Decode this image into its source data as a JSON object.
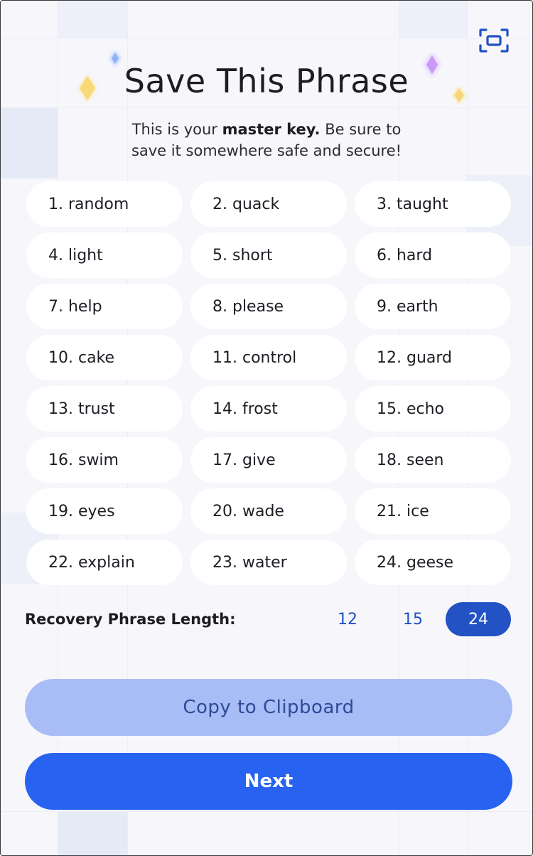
{
  "header": {
    "title": "Save This Phrase",
    "subtitle_pre": "This is your ",
    "subtitle_bold": "master key.",
    "subtitle_post": " Be sure to",
    "subtitle_line2": "save it somewhere safe and secure!",
    "expand_icon": "fullscreen-icon"
  },
  "words": [
    "1. random",
    "2. quack",
    "3. taught",
    "4. light",
    "5. short",
    "6. hard",
    "7. help",
    "8. please",
    "9. earth",
    "10. cake",
    "11. control",
    "12. guard",
    "13. trust",
    "14. frost",
    "15. echo",
    "16. swim",
    "17. give",
    "18. seen",
    "19. eyes",
    "20. wade",
    "21. ice",
    "22. explain",
    "23. water",
    "24. geese"
  ],
  "length": {
    "label": "Recovery Phrase Length:",
    "options": [
      "12",
      "15",
      "24"
    ],
    "selected": "24"
  },
  "actions": {
    "copy_label": "Copy to Clipboard",
    "next_label": "Next"
  },
  "colors": {
    "accent": "#2763f0",
    "selected_pill": "#2252c3",
    "copy_button": "#a8bcf6"
  }
}
